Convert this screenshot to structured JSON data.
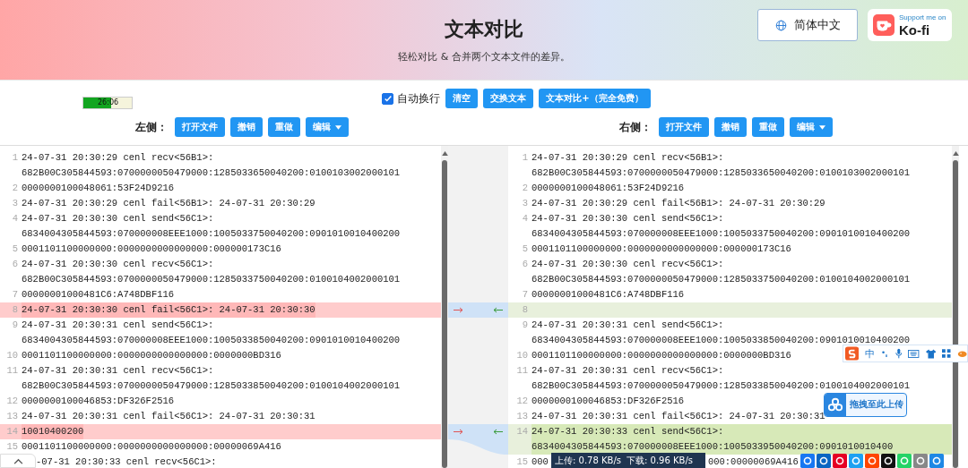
{
  "header": {
    "title": "文本对比",
    "subtitle": "轻松对比 & 合并两个文本文件的差异。",
    "language_button": "简体中文",
    "kofi": {
      "caption": "Support me on",
      "name": "Ko-fi"
    }
  },
  "timer": {
    "text": "26:06",
    "level": 0.58
  },
  "toolbar": {
    "auto_wrap": {
      "label": "自动换行",
      "checked": true
    },
    "buttons": [
      "清空",
      "交换文本",
      "文本对比+（完全免费）"
    ]
  },
  "sides": [
    {
      "label": "左侧：",
      "buttons": [
        {
          "label": "打开文件",
          "dropdown": false
        },
        {
          "label": "撤销",
          "dropdown": false
        },
        {
          "label": "重做",
          "dropdown": false
        },
        {
          "label": "编辑",
          "dropdown": true
        }
      ],
      "lines": [
        {
          "number": "1",
          "kind": "normal",
          "text": "24-07-31 20:30:29 cenl recv<56B1>: 682B00C305844593:0700000050479000:1285033650040200:0100103002000101"
        },
        {
          "number": "2",
          "kind": "normal",
          "text": "0000000100048061:53F24D9216"
        },
        {
          "number": "3",
          "kind": "normal",
          "text": "24-07-31 20:30:29 cenl fail<56B1>: 24-07-31 20:30:29"
        },
        {
          "number": "4",
          "kind": "normal",
          "text": "24-07-31 20:30:30 cenl send<56C1>: 6834004305844593:070000008EEE1000:1005033750040200:0901010010400200"
        },
        {
          "number": "5",
          "kind": "normal",
          "text": "0001101100000000:0000000000000000:000000173C16"
        },
        {
          "number": "6",
          "kind": "normal",
          "text": "24-07-31 20:30:30 cenl recv<56C1>: 682B00C305844593:0700000050479000:1285033750040200:0100104002000101"
        },
        {
          "number": "7",
          "kind": "normal",
          "text": "00000001000481C6:A748DBF116"
        },
        {
          "number": "8",
          "kind": "deleted",
          "text": "24-07-31 20:30:30 cenl fail<56C1>: 24-07-31 20:30:30"
        },
        {
          "number": "9",
          "kind": "normal",
          "text": "24-07-31 20:30:31 cenl send<56C1>: 6834004305844593:070000008EEE1000:1005033850040200:0901010010400200"
        },
        {
          "number": "10",
          "kind": "normal",
          "text": "0001101100000000:0000000000000000:0000000BD316"
        },
        {
          "number": "11",
          "kind": "normal",
          "text": "24-07-31 20:30:31 cenl recv<56C1>: 682B00C305844593:0700000050479000:1285033850040200:0100104002000101"
        },
        {
          "number": "12",
          "kind": "normal",
          "text": "0000000100046853:DF326F2516"
        },
        {
          "number": "13",
          "kind": "normal",
          "text": "24-07-31 20:30:31 cenl fail<56C1>: 24-07-31 20:30:31"
        },
        {
          "number": "14",
          "kind": "deleted",
          "text": "10010400200"
        },
        {
          "number": "15",
          "kind": "normal",
          "text": "0001101100000000:0000000000000000:00000069A416"
        },
        {
          "kind": "normal",
          "text": "-07-31 20:30:33 cenl recv<56C1>:"
        }
      ]
    },
    {
      "label": "右侧：",
      "buttons": [
        {
          "label": "打开文件",
          "dropdown": false
        },
        {
          "label": "撤销",
          "dropdown": false
        },
        {
          "label": "重做",
          "dropdown": false
        },
        {
          "label": "编辑",
          "dropdown": true
        }
      ],
      "lines": [
        {
          "number": "1",
          "kind": "normal",
          "text": "24-07-31 20:30:29 cenl recv<56B1>: 682B00C305844593:0700000050479000:1285033650040200:0100103002000101"
        },
        {
          "number": "2",
          "kind": "normal",
          "text": "0000000100048061:53F24D9216"
        },
        {
          "number": "3",
          "kind": "normal",
          "text": "24-07-31 20:30:29 cenl fail<56B1>: 24-07-31 20:30:29"
        },
        {
          "number": "4",
          "kind": "normal",
          "text": "24-07-31 20:30:30 cenl send<56C1>: 6834004305844593:070000008EEE1000:1005033750040200:0901010010400200"
        },
        {
          "number": "5",
          "kind": "normal",
          "text": "0001101100000000:0000000000000000:000000173C16"
        },
        {
          "number": "6",
          "kind": "normal",
          "text": "24-07-31 20:30:30 cenl recv<56C1>: 682B00C305844593:0700000050479000:1285033750040200:0100104002000101"
        },
        {
          "number": "7",
          "kind": "normal",
          "text": "00000001000481C6:A748DBF116"
        },
        {
          "number": "8",
          "kind": "empty"
        },
        {
          "number": "9",
          "kind": "normal",
          "text": "24-07-31 20:30:31 cenl send<56C1>: 6834004305844593:070000008EEE1000:1005033850040200:0901010010400200"
        },
        {
          "number": "10",
          "kind": "normal",
          "text": "0001101100000000:0000000000000000:0000000BD316"
        },
        {
          "number": "11",
          "kind": "normal",
          "text": "24-07-31 20:30:31 cenl recv<56C1>: 682B00C305844593:0700000050479000:1285033850040200:0100104002000101"
        },
        {
          "number": "12",
          "kind": "normal",
          "text": "0000000100046853:DF326F2516"
        },
        {
          "number": "13",
          "kind": "normal",
          "text": "24-07-31 20:30:31 cenl fail<56C1>: 24-07-31 20:30:31"
        },
        {
          "number": "14",
          "kind": "added",
          "text": "24-07-31 20:30:33 cenl send<56C1>: 6834004305844593:070000008EEE1000:1005033950040200:0901010010400"
        },
        {
          "number": "15",
          "kind": "normal",
          "segments": [
            "000",
            "000:00000069A416"
          ]
        }
      ]
    }
  ],
  "ime_bar": {
    "mode": "中"
  },
  "upload_button": "拖拽至此上传",
  "speed": {
    "upload": "上传: 0.78 KB/s",
    "download": "下载: 0.96 KB/s"
  }
}
